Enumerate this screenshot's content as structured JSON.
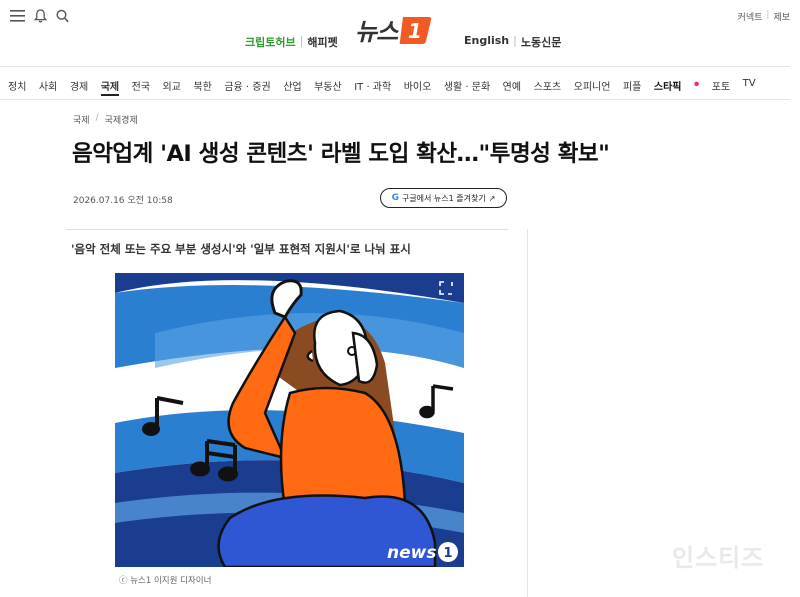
{
  "header": {
    "logo_text": "뉴스",
    "logo_badge": "1",
    "promo_left": [
      "크립토허브",
      "해피펫"
    ],
    "promo_right": [
      "English",
      "노동신문"
    ],
    "util_links": [
      "커넥트",
      "제보"
    ]
  },
  "nav": {
    "items": [
      "정치",
      "사회",
      "경제",
      "국제",
      "전국",
      "외교",
      "북한",
      "금융 · 증권",
      "산업",
      "부동산",
      "IT · 과학",
      "바이오",
      "생활 · 문화",
      "연예",
      "스포츠",
      "오피니언",
      "피플",
      "스타픽",
      "포토",
      "TV"
    ],
    "active": "국제"
  },
  "article": {
    "breadcrumb": [
      "국제",
      "국제경제"
    ],
    "headline": "음악업계 'AI 생성 콘텐츠' 라벨 도입 확산…\"투명성 확보\"",
    "dateline": "2026.07.16 오전 10:58",
    "google_button": "구글에서 뉴스1 즐겨찾기",
    "subhead": "'음악 전체 또는 주요 부분 생성시'와 '일부 표현적 지원시'로 나눠 표시",
    "image_badge": "news",
    "caption": "ⓒ 뉴스1 이지원 디자이너"
  },
  "watermark": "인스티즈",
  "colors": {
    "brand_orange": "#f15a22",
    "promo_green": "#2f9e30",
    "illust_blue": "#2b7fd0",
    "illust_navy": "#1b3d8f",
    "shirt_orange": "#ff6a13"
  }
}
